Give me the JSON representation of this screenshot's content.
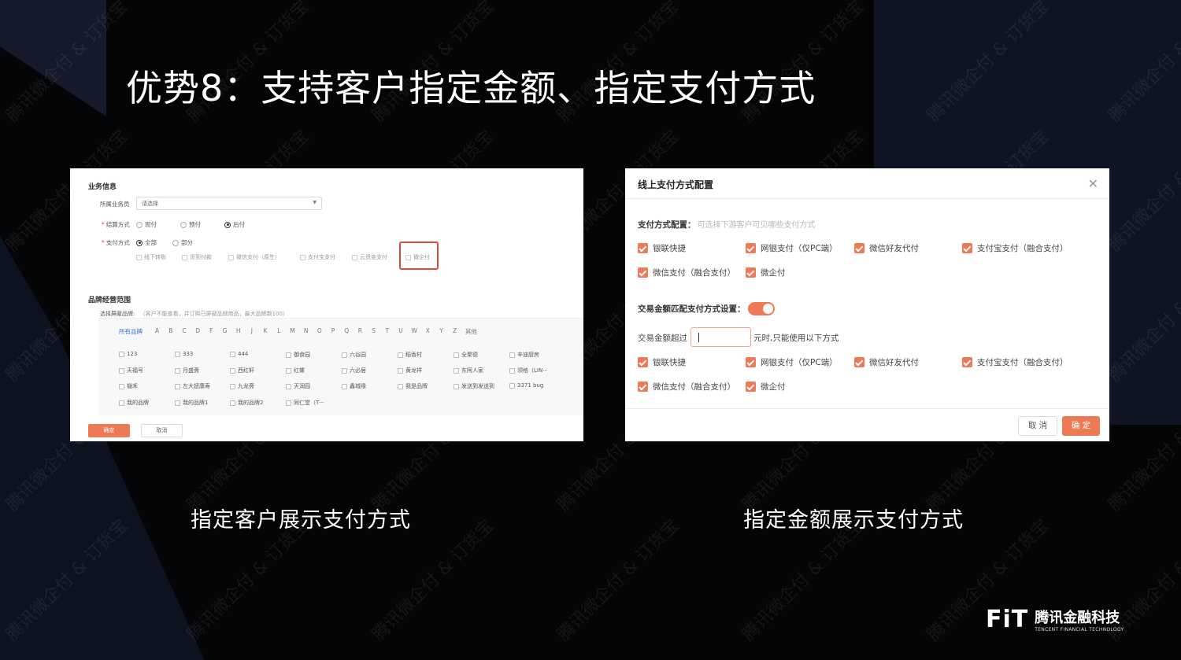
{
  "slide": {
    "title": "优势8：支持客户指定金额、指定支付方式",
    "watermark": "腾讯微企付 & 订货宝",
    "caption_left": "指定客户展示支付方式",
    "caption_right": "指定金额展示支付方式",
    "logo": {
      "mark": "FiT",
      "name_cn": "腾讯金融科技",
      "name_en": "TENCENT FINANCIAL TECHNOLOGY"
    }
  },
  "left_panel": {
    "section_business": "业务信息",
    "salesperson_label": "所属业务员",
    "salesperson_placeholder": "请选择",
    "settlement_label": "结算方式",
    "settlement_options": [
      {
        "label": "现付",
        "selected": false
      },
      {
        "label": "预付",
        "selected": false
      },
      {
        "label": "后付",
        "selected": true
      }
    ],
    "payment_label": "支付方式",
    "payment_scope_options": [
      {
        "label": "全部",
        "selected": true
      },
      {
        "label": "部分",
        "selected": false
      }
    ],
    "payment_methods": [
      "线下转账",
      "货到付款",
      "微信支付（原生）",
      "支付宝支付",
      "云资金支付",
      "微企付"
    ],
    "section_brand": "品牌经营范围",
    "brand_block_label": "选择屏蔽品牌:",
    "brand_block_hint": "（客户不能查看，并订购已屏蔽品牌商品，最大品牌数100）",
    "alphabet": [
      "所有品牌",
      "A",
      "B",
      "C",
      "D",
      "F",
      "G",
      "H",
      "J",
      "K",
      "L",
      "M",
      "N",
      "O",
      "P",
      "Q",
      "R",
      "S",
      "T",
      "U",
      "W",
      "X",
      "Y",
      "Z",
      "其他"
    ],
    "brands": [
      [
        "123",
        "333",
        "444",
        "御食园",
        "六谷园",
        "稻香村",
        "全聚德",
        "辛迪厨房"
      ],
      [
        "天福号",
        "月盛斋",
        "西红轩",
        "红螺",
        "六必居",
        "黄龙祥",
        "东阿人家",
        "领格（LIN···"
      ],
      [
        "锄禾",
        "左大妞康寿",
        "九龙斋",
        "天润园",
        "鑫城缘",
        "我是品牌",
        "发送到发送到",
        "3371 bug"
      ],
      [
        "我的品牌",
        "我的品牌1",
        "我的品牌2",
        "同仁堂（T···"
      ]
    ],
    "ok_label": "确定",
    "cancel_label": "取消"
  },
  "right_panel": {
    "title": "线上支付方式配置",
    "close_icon": "close-icon",
    "method_config_label": "支付方式配置：",
    "method_config_hint": "可选择下游客户可见哪些支付方式",
    "methods_row1": [
      "银联快捷",
      "网银支付（仅PC端）",
      "微信好友代付",
      "支付宝支付（融合支付）"
    ],
    "methods_row2": [
      "微信支付（融合支付）",
      "微企付"
    ],
    "amount_match_label": "交易金额匹配支付方式设置：",
    "amount_match_enabled": true,
    "amount_over_label": "交易金额超过",
    "amount_value": "",
    "amount_suffix": "元时,只能使用以下方式",
    "amount_methods_row1": [
      "银联快捷",
      "网银支付（仅PC端）",
      "微信好友代付",
      "支付宝支付（融合支付）"
    ],
    "amount_methods_row2": [
      "微信支付（融合支付）",
      "微企付"
    ],
    "cancel_label": "取 消",
    "ok_label": "确 定",
    "accent_color": "#ee7a55"
  }
}
